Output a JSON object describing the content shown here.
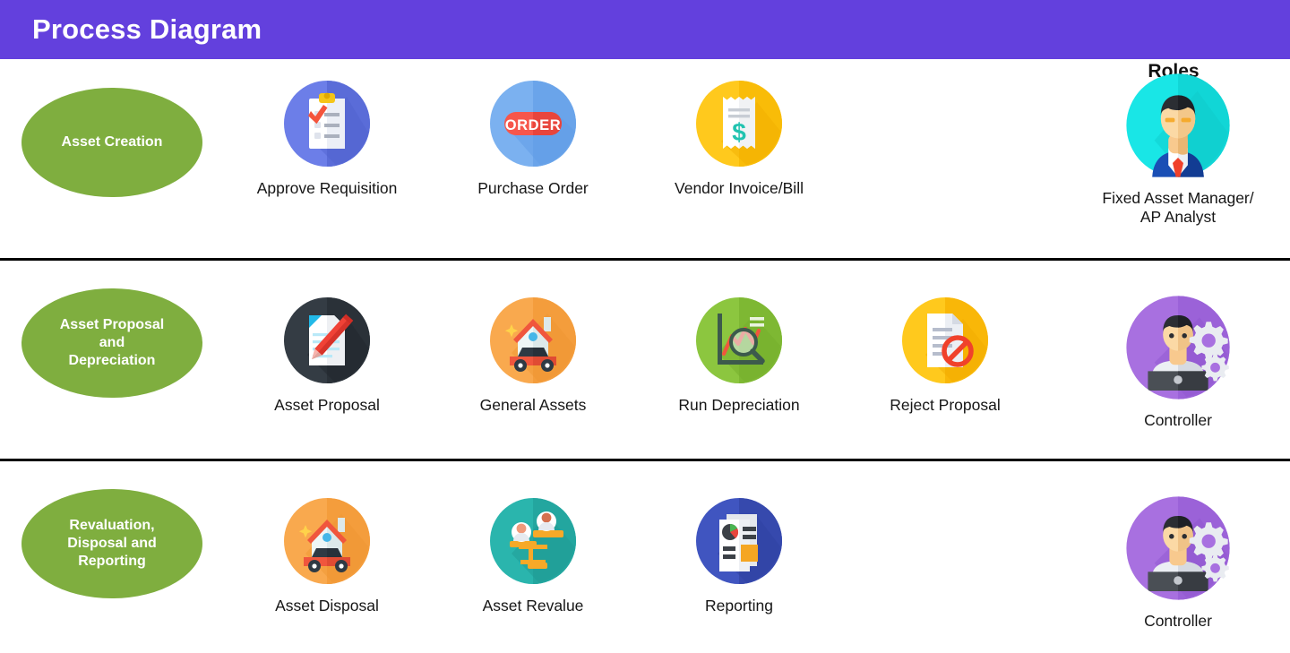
{
  "header": {
    "title": "Process Diagram",
    "background_color": "#6340dd",
    "text_color": "#ffffff"
  },
  "roles_column": {
    "heading": "Roles"
  },
  "palette": {
    "stage_green": "#7fae3f",
    "divider": "#000000",
    "caption_text": "#161616"
  },
  "rows": [
    {
      "stage": {
        "label": "Asset Creation",
        "icon": "ellipse-shape"
      },
      "steps": [
        {
          "label": "Approve Requisition",
          "icon": "clipboard-check-icon",
          "circle_color": "#6c7ee8"
        },
        {
          "label": "Purchase Order",
          "icon": "order-tag-icon",
          "circle_color": "#7bb1f0"
        },
        {
          "label": "Vendor Invoice/Bill",
          "icon": "invoice-receipt-icon",
          "circle_color": "#ffc91d"
        },
        {
          "label": "",
          "icon": "",
          "circle_color": ""
        }
      ],
      "role": {
        "label": "Fixed Asset Manager/\nAP Analyst",
        "icon": "businessman-avatar-icon",
        "circle_color": "#19e6e6"
      }
    },
    {
      "stage": {
        "label": "Asset Proposal\nand\nDepreciation",
        "icon": "ellipse-shape"
      },
      "steps": [
        {
          "label": "Asset Proposal",
          "icon": "document-pencil-icon",
          "circle_color": "#343c44"
        },
        {
          "label": "General Assets",
          "icon": "house-car-icon",
          "circle_color": "#f9a94e"
        },
        {
          "label": "Run Depreciation",
          "icon": "chart-magnifier-icon",
          "circle_color": "#8cc63f"
        },
        {
          "label": "Reject Proposal",
          "icon": "document-blocked-icon",
          "circle_color": "#ffc91d"
        }
      ],
      "role": {
        "label": "Controller",
        "icon": "controller-laptop-gears-icon",
        "circle_color": "#a870e0"
      }
    },
    {
      "stage": {
        "label": "Revaluation,\nDisposal and\nReporting",
        "icon": "ellipse-shape"
      },
      "steps": [
        {
          "label": "Asset Disposal",
          "icon": "house-car-icon",
          "circle_color": "#f9a94e"
        },
        {
          "label": "Asset Revalue",
          "icon": "balance-scale-people-icon",
          "circle_color": "#2ab5ad"
        },
        {
          "label": "Reporting",
          "icon": "report-pages-icon",
          "circle_color": "#4055c0"
        },
        {
          "label": "",
          "icon": "",
          "circle_color": ""
        }
      ],
      "role": {
        "label": "Controller",
        "icon": "controller-laptop-gears-icon",
        "circle_color": "#a870e0"
      }
    }
  ]
}
